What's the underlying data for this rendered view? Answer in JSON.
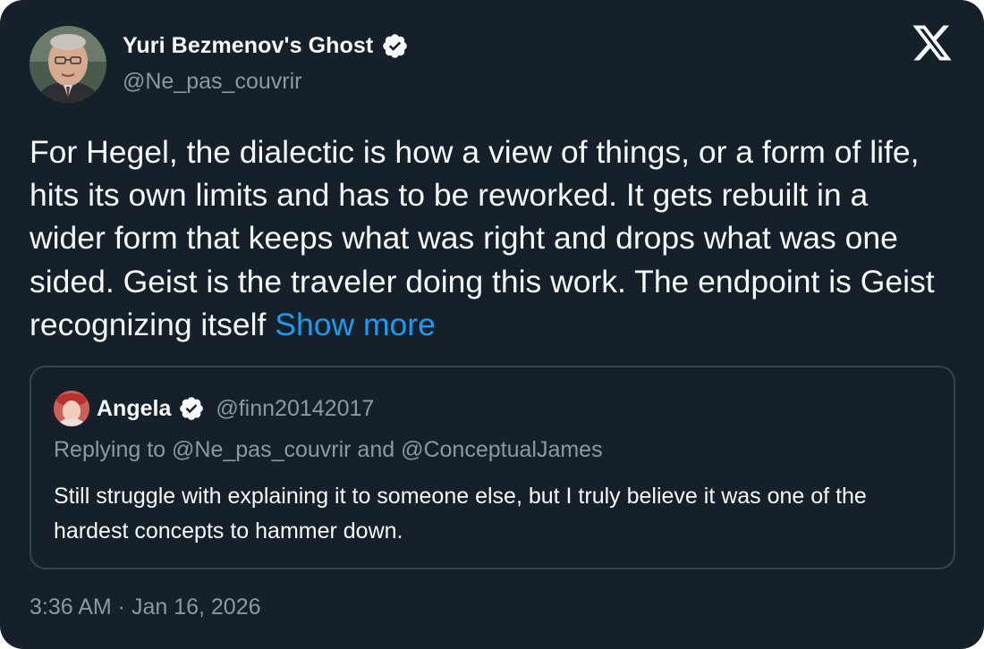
{
  "author": {
    "name": "Yuri Bezmenov's Ghost",
    "handle": "@Ne_pas_couvrir",
    "verified": true,
    "avatar_icon": "portrait-avatar"
  },
  "platform_icon": "x-logo-icon",
  "tweet": {
    "text": "For Hegel, the dialectic is how a view of things, or a form of life, hits its own limits and has to be reworked. It gets rebuilt in a wider form that keeps what was right and drops what was one sided. Geist is the traveler doing this work. The endpoint is Geist recognizing itself",
    "show_more_label": "Show more"
  },
  "quoted_tweet": {
    "name": "Angela",
    "handle": "@finn20142017",
    "verified": true,
    "replying_to": "Replying to @Ne_pas_couvrir and @ConceptualJames",
    "text": "Still struggle with explaining it to someone else, but I truly believe it was one of the hardest concepts to hammer down."
  },
  "timestamp": "3:36 AM · Jan 16, 2026",
  "colors": {
    "background": "#15202b",
    "text_primary": "#f7f9f9",
    "text_secondary": "#8b98a5",
    "link": "#1d9bf0",
    "border": "#38444d"
  }
}
